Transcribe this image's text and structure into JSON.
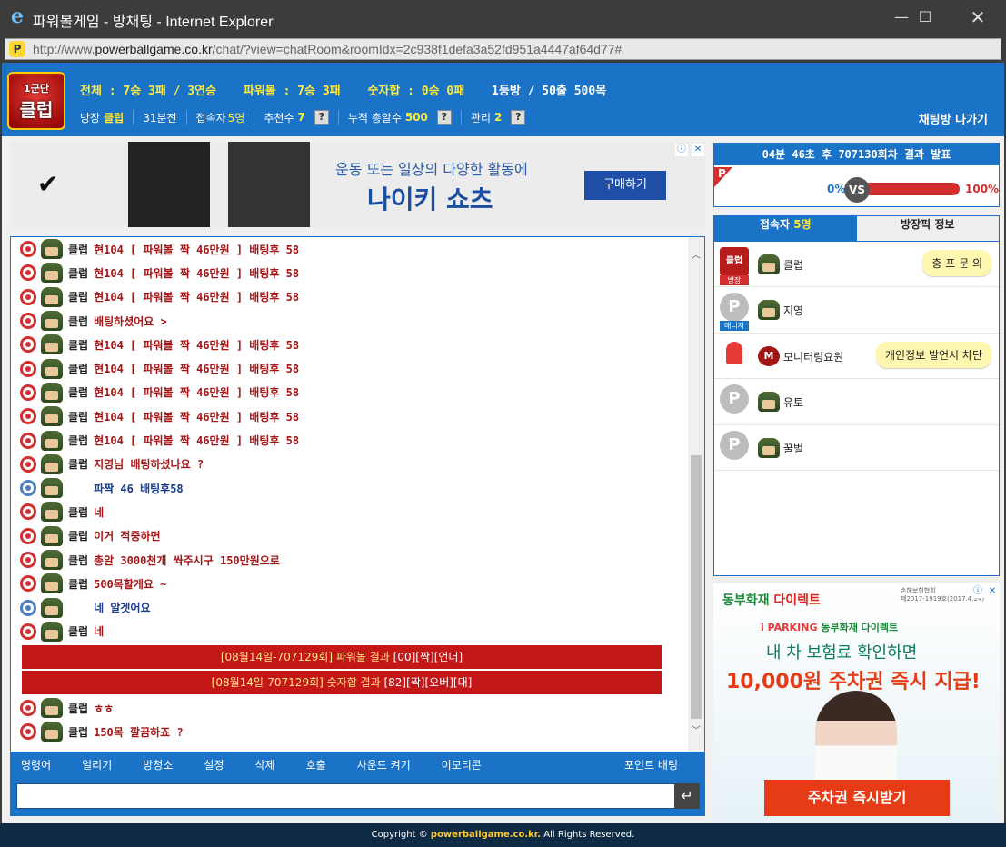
{
  "window": {
    "title": "파워볼게임 - 방채팅 - Internet Explorer",
    "url_prefix": "http://www.",
    "url_host": "powerballgame.co.kr",
    "url_path": "/chat/?view=chatRoom&roomIdx=2c938f1defa3a52fd951a4447af64d77#"
  },
  "header": {
    "logo_top": "1군단",
    "logo_main": "클럽",
    "stats": [
      "전체 : 7승 3패 / 3연승",
      "파워볼 : 7승 3패",
      "숫자합 : 0승 0패",
      "1등방 / 50출 500목"
    ],
    "owner_label": "방장",
    "owner_value": "클럽",
    "time": "31분전",
    "users_label": "접속자",
    "users_value": "5명",
    "rec_label": "추천수",
    "rec_value": "7",
    "total_label": "누적 총알수",
    "total_value": "500",
    "admin_label": "관리",
    "admin_value": "2",
    "exit_label": "채팅방 나가기",
    "help": "?"
  },
  "ad_top": {
    "line1": "운동 또는 일상의 다양한 활동에",
    "line2": "나이키 쇼츠",
    "button": "구매하기"
  },
  "chat": {
    "messages": [
      {
        "user": "클럽",
        "text": "현104 [ 파워볼 짝 46만원 ] 배팅후 58",
        "blue": false
      },
      {
        "user": "클럽",
        "text": "현104 [ 파워볼 짝 46만원 ] 배팅후 58",
        "blue": false
      },
      {
        "user": "클럽",
        "text": "현104 [ 파워볼 짝 46만원 ] 배팅후 58",
        "blue": false
      },
      {
        "user": "클럽",
        "text": "배팅하셨어요 >",
        "blue": false
      },
      {
        "user": "클럽",
        "text": "현104 [ 파워볼 짝 46만원 ] 배팅후 58",
        "blue": false
      },
      {
        "user": "클럽",
        "text": "현104 [ 파워볼 짝 46만원 ] 배팅후 58",
        "blue": false
      },
      {
        "user": "클럽",
        "text": "현104 [ 파워볼 짝 46만원 ] 배팅후 58",
        "blue": false
      },
      {
        "user": "클럽",
        "text": "현104 [ 파워볼 짝 46만원 ] 배팅후 58",
        "blue": false
      },
      {
        "user": "클럽",
        "text": "현104 [ 파워볼 짝 46만원 ] 배팅후 58",
        "blue": false
      },
      {
        "user": "클럽",
        "text": "지영님 배팅하셨나요 ?",
        "blue": false
      },
      {
        "user": "",
        "text": "파짝 46 배팅후58",
        "blue": true
      },
      {
        "user": "클럽",
        "text": "네",
        "blue": false
      },
      {
        "user": "클럽",
        "text": "이거 적중하면",
        "blue": false
      },
      {
        "user": "클럽",
        "text": "총알 3000천개 쏴주시구 150만원으로",
        "blue": false
      },
      {
        "user": "클럽",
        "text": "500목할게요 ~",
        "blue": false
      },
      {
        "user": "",
        "text": "네 알겟어요",
        "blue": true
      },
      {
        "user": "클럽",
        "text": "네",
        "blue": false
      }
    ],
    "results": [
      {
        "prefix": "[08월14일-707129회] 파워볼 결과 ",
        "value": "[00][짝][언더]"
      },
      {
        "prefix": "[08월14일-707129회] 숫자합 결과 ",
        "value": "[82][짝][오버][대]"
      }
    ],
    "after": [
      {
        "user": "클럽",
        "text": "ㅎㅎ",
        "blue": false
      },
      {
        "user": "클럽",
        "text": "150목 깔끔하죠 ?",
        "blue": false
      }
    ]
  },
  "menu": [
    "명령어",
    "얼리기",
    "방청소",
    "설정",
    "삭제",
    "호출",
    "사운드 켜기",
    "이모티콘"
  ],
  "menu_point": "포인트 배팅",
  "input": {
    "value": "",
    "send": "↵"
  },
  "notice": {
    "title": "04분 46초 후 707130회차 결과 발표",
    "p": "P",
    "left_pct": "0%",
    "vs": "VS",
    "right_pct": "100%",
    "right_fraction": 1.0
  },
  "users": {
    "tab1_label": "접속자",
    "tab1_count": "5명",
    "tab2_label": "방장픽 정보",
    "list": [
      {
        "name": "클럽",
        "tag": "방장",
        "bubble": "충 프 문 의",
        "badge": "클럽"
      },
      {
        "name": "지영",
        "tag": "매니저",
        "bubble": "",
        "badge": "P"
      },
      {
        "name": "모니터링요원",
        "tag": "",
        "bubble": "개인정보 발언시 차단",
        "badge": ""
      },
      {
        "name": "유토",
        "tag": "",
        "bubble": "",
        "badge": "P"
      },
      {
        "name": "꿀벌",
        "tag": "",
        "bubble": "",
        "badge": "P"
      }
    ]
  },
  "ad_side": {
    "brand1": "동부화재",
    "brand2": "다이렉트",
    "small1": "손해보험협회",
    "small2": "제2017-1919호(2017.4.24)",
    "park1": "i PARKING",
    "park2": "동부화재 다이렉트",
    "line1": "내 차 보험료 확인하면",
    "line2": "10,000원 주차권 즉시 지급!",
    "cta": "주차권 즉시받기"
  },
  "footer": {
    "prefix": "Copyright © ",
    "domain": "powerballgame.co.kr.",
    "suffix": " All Rights Reserved."
  },
  "colors": {
    "accent": "#1a73c6",
    "result_bg": "#c41818",
    "footer_bg": "#0f2a44"
  }
}
